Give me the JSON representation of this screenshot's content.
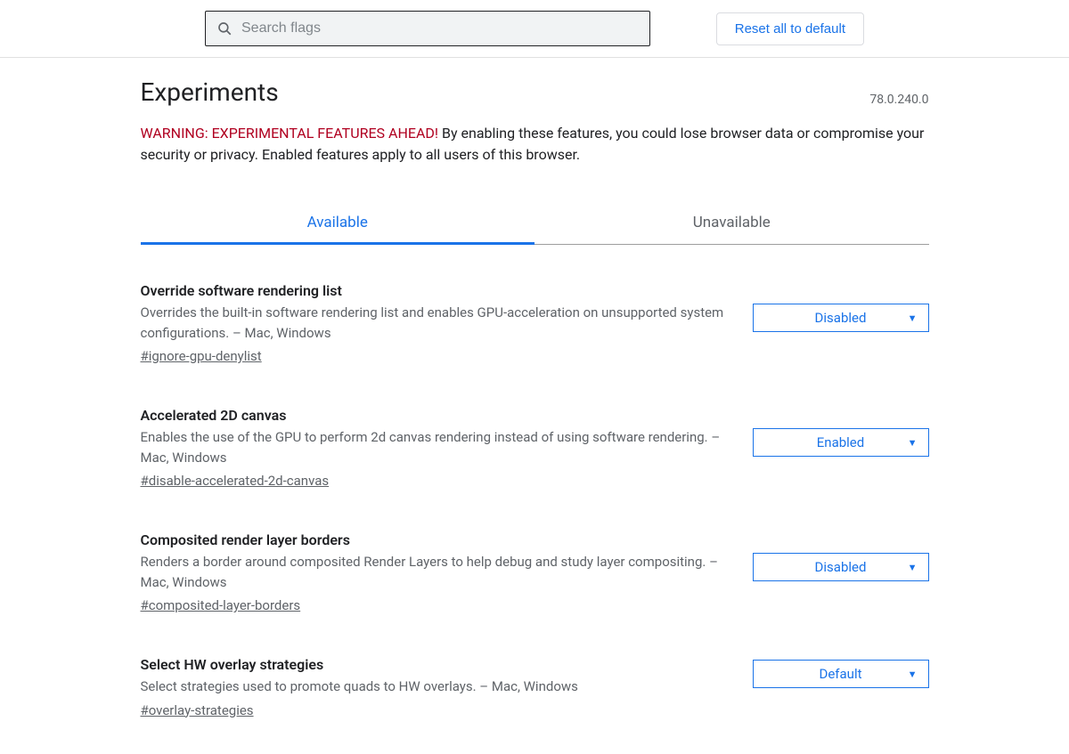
{
  "search": {
    "placeholder": "Search flags"
  },
  "reset_button_label": "Reset all to default",
  "page_title": "Experiments",
  "version": "78.0.240.0",
  "warning_prefix": "WARNING: EXPERIMENTAL FEATURES AHEAD!",
  "warning_body": " By enabling these features, you could lose browser data or compromise your security or privacy. Enabled features apply to all users of this browser.",
  "tabs": {
    "available": "Available",
    "unavailable": "Unavailable"
  },
  "flags": [
    {
      "title": "Override software rendering list",
      "description": "Overrides the built-in software rendering list and enables GPU-acceleration on unsupported system configurations. – Mac, Windows",
      "hash": "#ignore-gpu-denylist",
      "value": "Disabled"
    },
    {
      "title": "Accelerated 2D canvas",
      "description": "Enables the use of the GPU to perform 2d canvas rendering instead of using software rendering. – Mac, Windows",
      "hash": "#disable-accelerated-2d-canvas",
      "value": "Enabled"
    },
    {
      "title": "Composited render layer borders",
      "description": "Renders a border around composited Render Layers to help debug and study layer compositing. – Mac, Windows",
      "hash": "#composited-layer-borders",
      "value": "Disabled"
    },
    {
      "title": "Select HW overlay strategies",
      "description": "Select strategies used to promote quads to HW overlays. – Mac, Windows",
      "hash": "#overlay-strategies",
      "value": "Default"
    }
  ]
}
